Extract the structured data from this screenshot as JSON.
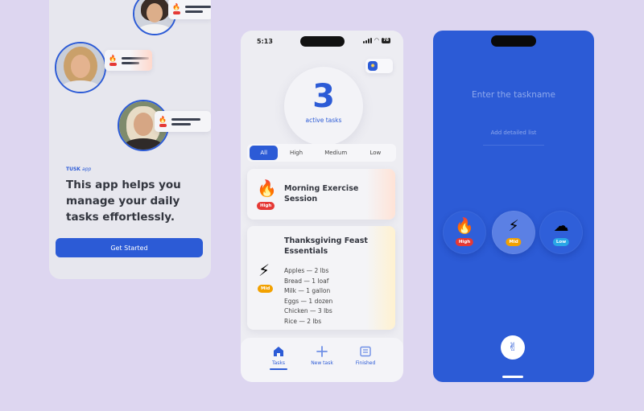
{
  "onboarding": {
    "brand": "TUSK",
    "brand_suffix": "app",
    "headline": "This app helps you manage your daily tasks effortlessly.",
    "cta_label": "Get Started",
    "preview_cards": [
      {
        "priority": "High",
        "icon": "fire-icon"
      },
      {
        "priority": "High",
        "icon": "fire-icon"
      },
      {
        "priority": "High",
        "icon": "fire-icon"
      }
    ]
  },
  "tasks_screen": {
    "status_bar": {
      "time": "5:13",
      "battery": "78"
    },
    "active_count": "3",
    "active_label": "active tasks",
    "theme_icon": "sun-icon",
    "filters": [
      "All",
      "High",
      "Medium",
      "Low"
    ],
    "active_filter": "All",
    "tasks": [
      {
        "title": "Morning Exercise Session",
        "priority": "High",
        "icon": "fire-icon",
        "items": []
      },
      {
        "title": "Thanksgiving Feast Essentials",
        "priority": "Mid",
        "icon": "lightning-icon",
        "items": [
          "Apples — 2 lbs",
          "Bread — 1 loaf",
          "Milk — 1 gallon",
          "Eggs — 1 dozen",
          "Chicken — 3 lbs",
          "Rice — 2 lbs"
        ]
      }
    ],
    "tabbar": [
      {
        "label": "Tasks",
        "icon": "home-icon",
        "active": true
      },
      {
        "label": "New task",
        "icon": "plus-icon",
        "active": false
      },
      {
        "label": "Finished",
        "icon": "list-icon",
        "active": false
      }
    ]
  },
  "new_task_screen": {
    "taskname_placeholder": "Enter the taskname",
    "detail_placeholder": "Add detailed list",
    "priorities": [
      {
        "label": "High",
        "icon": "fire-icon",
        "selected": false
      },
      {
        "label": "Mid",
        "icon": "lightning-icon",
        "selected": true
      },
      {
        "label": "Low",
        "icon": "cloud-icon",
        "selected": false
      }
    ],
    "confirm_icon": "hand-ok-icon"
  },
  "colors": {
    "background": "#ddd6f0",
    "accent": "#2c5bd6",
    "high": "#e53935",
    "mid": "#f2a100",
    "low": "#2aa7e6"
  }
}
